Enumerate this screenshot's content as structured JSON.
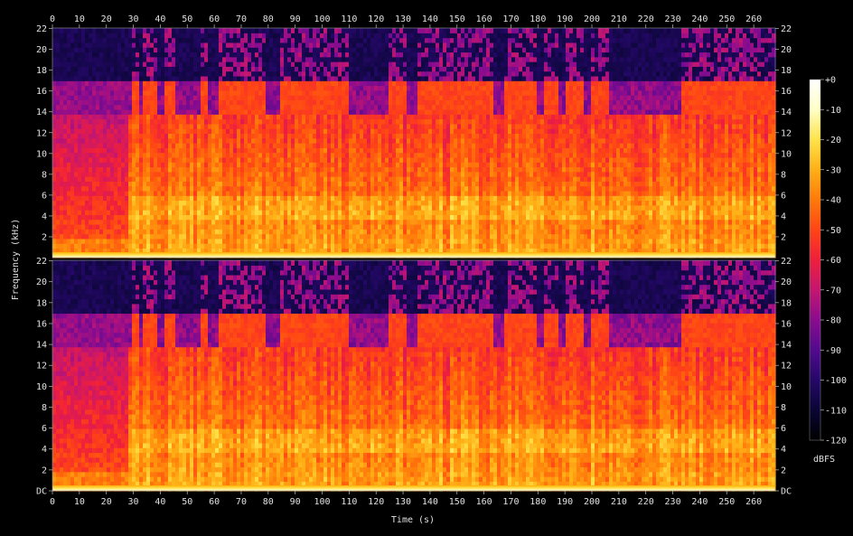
{
  "chart_data": {
    "type": "heatmap",
    "title": "",
    "xlabel": "Time (s)",
    "ylabel": "Frequency (kHz)",
    "xlim": [
      0,
      268
    ],
    "ylim_khz": [
      0,
      22.05
    ],
    "x_ticks": [
      0,
      10,
      20,
      30,
      40,
      50,
      60,
      70,
      80,
      90,
      100,
      110,
      120,
      130,
      140,
      150,
      160,
      170,
      180,
      190,
      200,
      210,
      220,
      230,
      240,
      250,
      260
    ],
    "channels": [
      {
        "y_ticks": [
          {
            "value": 2,
            "label": "2"
          },
          {
            "value": 4,
            "label": "4"
          },
          {
            "value": 6,
            "label": "6"
          },
          {
            "value": 8,
            "label": "8"
          },
          {
            "value": 10,
            "label": "10"
          },
          {
            "value": 12,
            "label": "12"
          },
          {
            "value": 14,
            "label": "14"
          },
          {
            "value": 16,
            "label": "16"
          },
          {
            "value": 18,
            "label": "18"
          },
          {
            "value": 20,
            "label": "20"
          },
          {
            "value": 22,
            "label": "22"
          }
        ]
      },
      {
        "y_ticks": [
          {
            "value": 0,
            "label": "DC"
          },
          {
            "value": 2,
            "label": "2"
          },
          {
            "value": 4,
            "label": "4"
          },
          {
            "value": 6,
            "label": "6"
          },
          {
            "value": 8,
            "label": "8"
          },
          {
            "value": 10,
            "label": "10"
          },
          {
            "value": 12,
            "label": "12"
          },
          {
            "value": 14,
            "label": "14"
          },
          {
            "value": 16,
            "label": "16"
          },
          {
            "value": 18,
            "label": "18"
          },
          {
            "value": 20,
            "label": "20"
          },
          {
            "value": 22,
            "label": "22"
          }
        ]
      }
    ],
    "colorbar": {
      "label": "dBFS",
      "range": [
        -120,
        0
      ],
      "ticks": [
        {
          "value": 0,
          "label": "+0"
        },
        {
          "value": -10,
          "label": "-10"
        },
        {
          "value": -20,
          "label": "-20"
        },
        {
          "value": -30,
          "label": "-30"
        },
        {
          "value": -40,
          "label": "-40"
        },
        {
          "value": -50,
          "label": "-50"
        },
        {
          "value": -60,
          "label": "-60"
        },
        {
          "value": -70,
          "label": "-70"
        },
        {
          "value": -80,
          "label": "-80"
        },
        {
          "value": -90,
          "label": "-90"
        },
        {
          "value": -100,
          "label": "-100"
        },
        {
          "value": -110,
          "label": "-110"
        },
        {
          "value": -120,
          "label": "-120"
        }
      ],
      "colors": [
        "#000000",
        "#0a0634",
        "#250869",
        "#520a8e",
        "#8a0c8f",
        "#c41670",
        "#ef1f3c",
        "#ff4515",
        "#ff7a0a",
        "#ffb016",
        "#ffe34a",
        "#ffffc8",
        "#ffffff"
      ]
    },
    "cutoff_khz": 16.5,
    "loud_segments": [
      [
        29,
        32
      ],
      [
        34,
        39
      ],
      [
        42,
        46
      ],
      [
        55,
        58
      ],
      [
        62,
        79
      ],
      [
        85,
        110
      ],
      [
        124,
        131
      ],
      [
        136,
        150
      ],
      [
        150,
        163
      ],
      [
        167,
        180
      ],
      [
        182,
        188
      ],
      [
        190,
        197
      ],
      [
        200,
        206
      ],
      [
        233,
        246
      ],
      [
        247,
        268
      ]
    ]
  }
}
